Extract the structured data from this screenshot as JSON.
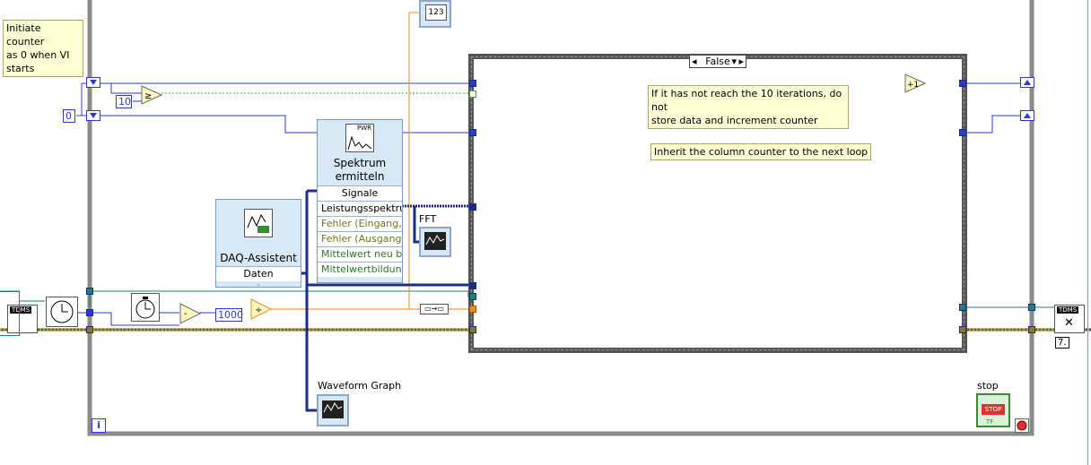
{
  "comments": {
    "init_counter": "Initiate counter\nas 0 when VI\nstarts",
    "not_reached": "If it has not reach the 10 iterations, do not\nstore data and increment counter",
    "inherit": "Inherit the column counter to the next loop"
  },
  "constants": {
    "zero": "0",
    "ten": "10",
    "thousand": "1000"
  },
  "case_structure": {
    "selector": "False"
  },
  "spectrum_vi": {
    "icon_text": "PWR",
    "title_line1": "Spektrum",
    "title_line2": "ermitteln",
    "terminals": [
      "Signale",
      "Leistungsspektru",
      "Fehler (Eingang,",
      "Fehler (Ausgang",
      "Mittelwert neu b",
      "Mittelwertbildun"
    ]
  },
  "daq_assistant": {
    "title": "DAQ-Assistent",
    "output": "Daten"
  },
  "indicators": {
    "numeric_display": "123",
    "fft_label": "FFT",
    "waveform_label": "Waveform Graph",
    "stop_label": "stop",
    "stop_button": "STOP",
    "tf": "TF"
  },
  "tdms": {
    "left_icon": "TDMS",
    "right_icon": "TDMS",
    "number": "7."
  },
  "loop": {
    "iteration": "i"
  },
  "colors": {
    "int_wire": "#2b3bd1",
    "double_wire": "#f28a1e",
    "error_wire": "#8a7a1a",
    "refnum_wire": "#1e7f7f",
    "loop_border": "#8a8a8a"
  }
}
